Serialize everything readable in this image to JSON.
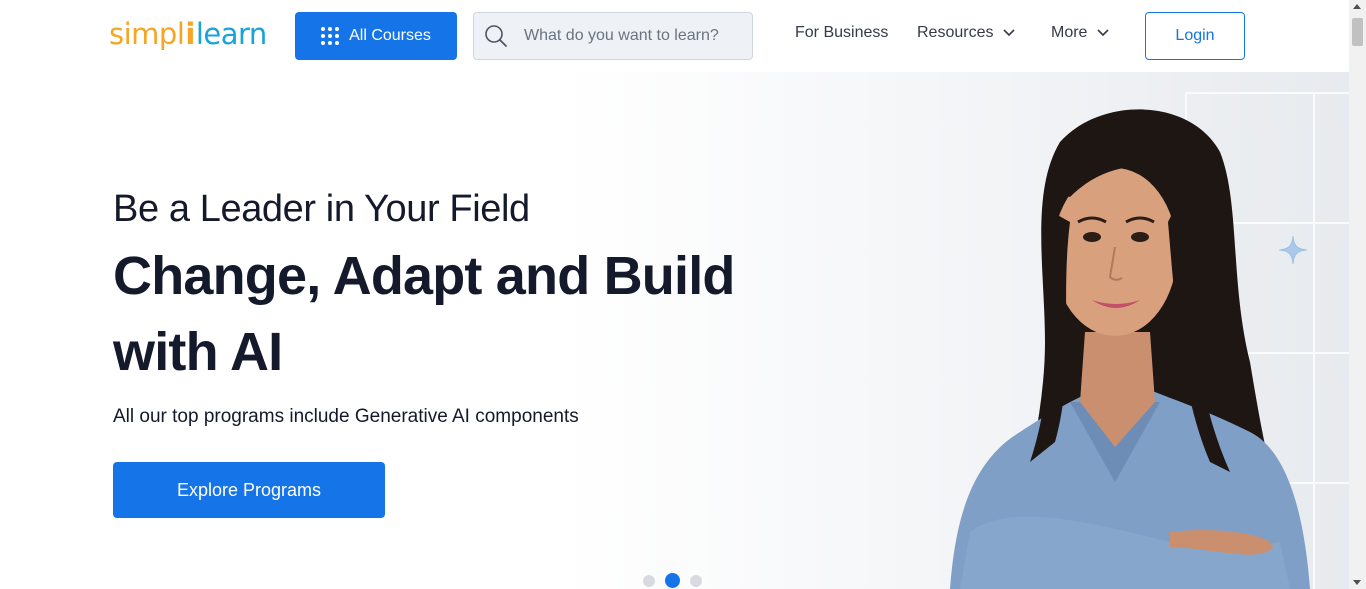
{
  "header": {
    "logo": {
      "part1": "simpl",
      "divider": "i",
      "part2": "learn"
    },
    "all_courses_label": "All Courses",
    "search": {
      "placeholder": "What do you want to learn?",
      "value": ""
    },
    "nav": {
      "for_business": "For Business",
      "resources": "Resources",
      "more": "More"
    },
    "login_label": "Login"
  },
  "hero": {
    "eyebrow": "Be a Leader in Your Field",
    "headline": "Change, Adapt and Build with AI",
    "subtext": "All our top programs include Generative AI components",
    "cta_label": "Explore Programs",
    "carousel": {
      "total_slides": 3,
      "active_slide": 2
    }
  },
  "icons": {
    "search": "search-icon",
    "grid": "grid-dots-icon",
    "chevron": "chevron-down-icon",
    "sparkle": "sparkle-icon"
  },
  "colors": {
    "primary": "#1574e8",
    "logo_orange": "#f5a623",
    "logo_blue": "#1aa3d9",
    "text_dark": "#141a2b"
  }
}
